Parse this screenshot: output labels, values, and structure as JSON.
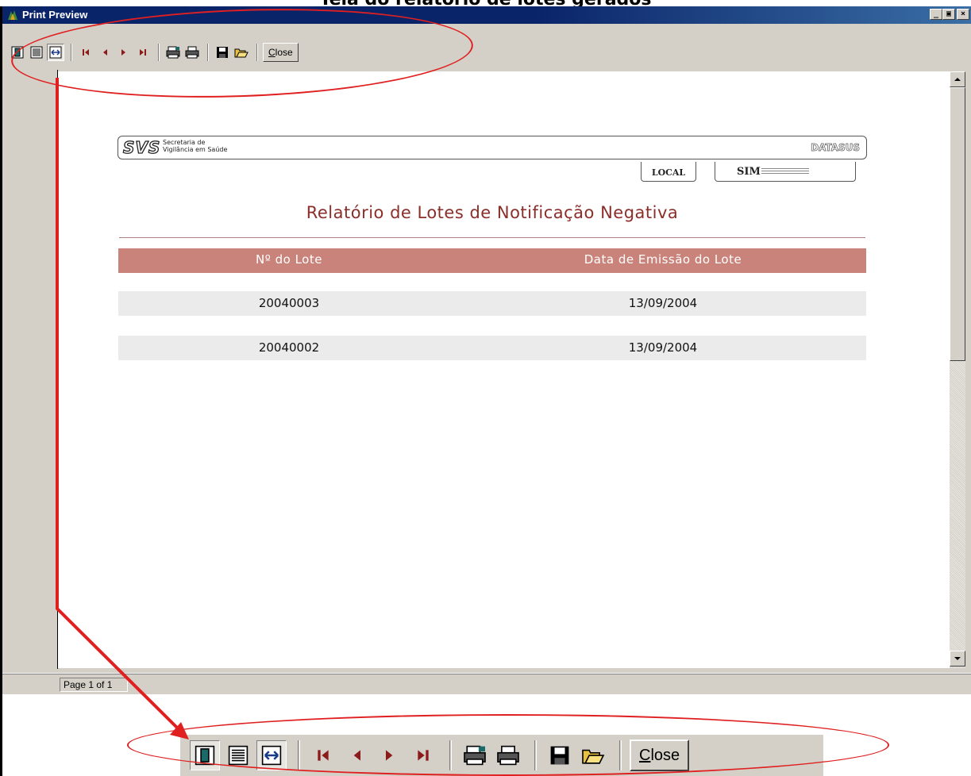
{
  "document": {
    "heading": "Tela do relatório de lotes gerados"
  },
  "window": {
    "title": "Print Preview",
    "buttons": {
      "minimize": "_",
      "maximize": "▣",
      "close": "×"
    }
  },
  "toolbar": {
    "close_label": "Close",
    "icons": [
      "one-page-view-icon",
      "page-width-view-icon",
      "zoom-fit-icon",
      "first-page-icon",
      "previous-page-icon",
      "next-page-icon",
      "last-page-icon",
      "print-setup-icon",
      "print-icon",
      "save-icon",
      "open-icon"
    ]
  },
  "report": {
    "header": {
      "org_short": "SVS",
      "org_line1": "Secretaria de",
      "org_line2": "Vigilância em Saúde",
      "partner": "DATASUS",
      "local_label": "LOCAL",
      "system": "SIM"
    },
    "title": "Relatório de Lotes de Notificação Negativa",
    "columns": [
      "Nº do Lote",
      "Data de Emissão do Lote"
    ],
    "rows": [
      {
        "lote": "20040003",
        "data": "13/09/2004"
      },
      {
        "lote": "20040002",
        "data": "13/09/2004"
      }
    ]
  },
  "status": {
    "page_info": "Page 1 of 1"
  },
  "colors": {
    "title_bar": "#0a246a",
    "report_title": "#8b2e2a",
    "table_header": "#c9837a",
    "row_bg": "#ebebeb",
    "annotation": "#e02020"
  }
}
